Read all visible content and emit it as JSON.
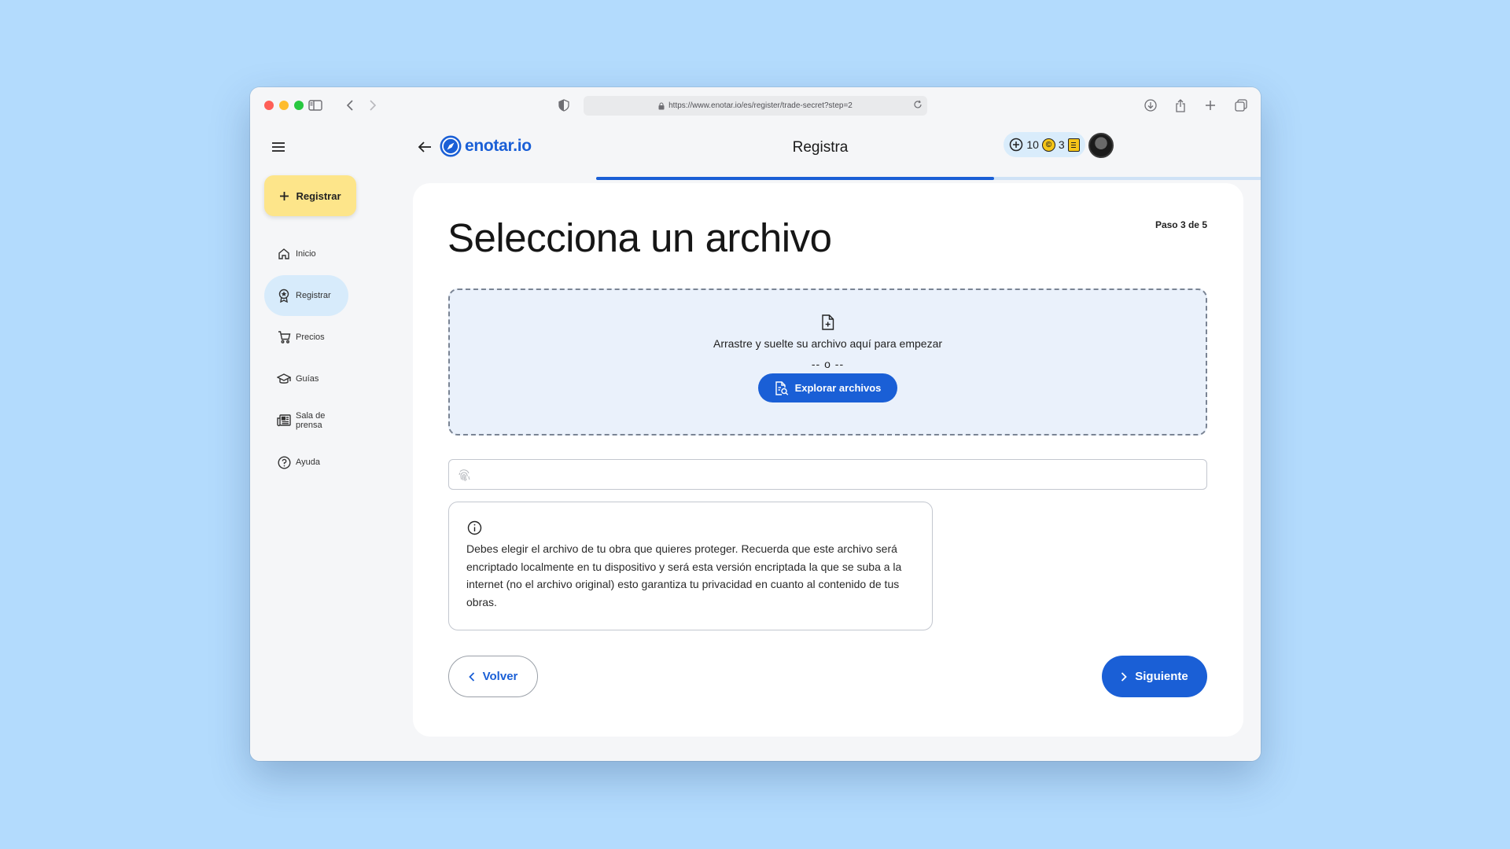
{
  "browser": {
    "url": "https://www.enotar.io/es/register/trade-secret?step=2"
  },
  "sidebar": {
    "register_button": "Registrar",
    "items": [
      {
        "label": "Inicio",
        "icon": "home-icon",
        "active": false
      },
      {
        "label": "Registrar",
        "icon": "award-icon",
        "active": true
      },
      {
        "label": "Precios",
        "icon": "cart-icon",
        "active": false
      },
      {
        "label": "Guías",
        "icon": "graduation-cap-icon",
        "active": false
      },
      {
        "label": "Sala de prensa",
        "icon": "newspaper-icon",
        "active": false
      },
      {
        "label": "Ayuda",
        "icon": "help-circle-icon",
        "active": false
      }
    ]
  },
  "header": {
    "logo": "enotar.io",
    "title": "Registra",
    "credits_count": "10",
    "coins_count": "3",
    "progress_fraction": 0.49
  },
  "main": {
    "step_label": "Paso 3 de 5",
    "title": "Selecciona un archivo",
    "dropzone_text": "Arrastre y suelte su archivo aquí para empezar",
    "dropzone_or": "-- o --",
    "explore_button": "Explorar archivos",
    "info_text": "Debes elegir el archivo de tu obra que quieres proteger. Recuerda que este archivo será encriptado localmente en tu dispositivo y será esta versión encriptada la que se suba a la internet (no el archivo original) esto garantiza tu privacidad en cuanto al contenido de tus obras.",
    "back_button": "Volver",
    "next_button": "Siguiente"
  },
  "colors": {
    "accent": "#1a5fd6",
    "background": "#b3dbfd",
    "register_button": "#fde58a",
    "active_nav": "#d7ebfb"
  }
}
